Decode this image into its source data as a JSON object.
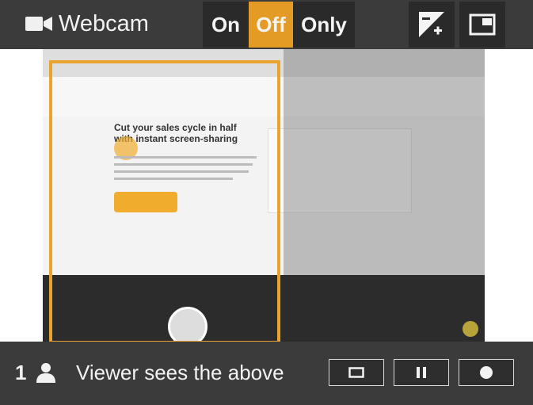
{
  "header": {
    "camera_icon": "video-camera-icon",
    "camera_label": "Webcam",
    "modes": {
      "on_label": "On",
      "off_label": "Off",
      "only_label": "Only",
      "selected": "Off"
    },
    "brightness_icon": "brightness-contrast-icon",
    "pip_icon": "picture-in-picture-icon"
  },
  "preview": {
    "headline": "Cut your sales cycle in half with instant screen-sharing"
  },
  "footer": {
    "viewer_count": "1",
    "viewer_icon": "person-icon",
    "viewer_label": "Viewer sees the above",
    "controls": [
      "stop-square-icon",
      "pause-icon",
      "record-icon"
    ]
  },
  "colors": {
    "accent": "#e49b26",
    "bar_bg": "#3b3b3b",
    "button_bg": "#2a2a2a"
  }
}
